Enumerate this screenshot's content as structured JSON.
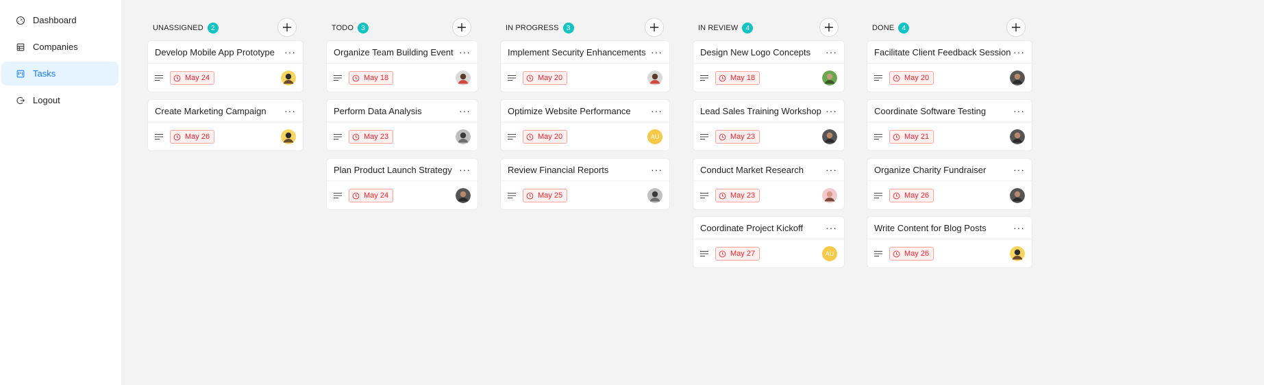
{
  "sidebar": {
    "items": [
      {
        "label": "Dashboard",
        "icon": "dashboard-icon",
        "active": false
      },
      {
        "label": "Companies",
        "icon": "shop-icon",
        "active": false
      },
      {
        "label": "Tasks",
        "icon": "project-icon",
        "active": true
      },
      {
        "label": "Logout",
        "icon": "logout-icon",
        "active": false
      }
    ]
  },
  "colors": {
    "accent": "#1677ff",
    "count_badge": "#13c2c2",
    "date_tag": "#f5222d"
  },
  "columns": [
    {
      "title": "UNASSIGNED",
      "count": "2",
      "cards": [
        {
          "title": "Develop Mobile App Prototype",
          "date": "May 24",
          "avatar": "photo-yellow"
        },
        {
          "title": "Create Marketing Campaign",
          "date": "May 26",
          "avatar": "photo-yellow"
        }
      ]
    },
    {
      "title": "TODO",
      "count": "3",
      "cards": [
        {
          "title": "Organize Team Building Event",
          "date": "May 18",
          "avatar": "photo-red"
        },
        {
          "title": "Perform Data Analysis",
          "date": "May 23",
          "avatar": "photo-gray"
        },
        {
          "title": "Plan Product Launch Strategy",
          "date": "May 24",
          "avatar": "photo-dark"
        }
      ]
    },
    {
      "title": "IN PROGRESS",
      "count": "3",
      "cards": [
        {
          "title": "Implement Security Enhancements",
          "date": "May 20",
          "avatar": "photo-red"
        },
        {
          "title": "Optimize Website Performance",
          "date": "May 20",
          "avatar": "initials",
          "initials": "AU"
        },
        {
          "title": "Review Financial Reports",
          "date": "May 25",
          "avatar": "photo-gray"
        }
      ]
    },
    {
      "title": "IN REVIEW",
      "count": "4",
      "cards": [
        {
          "title": "Design New Logo Concepts",
          "date": "May 18",
          "avatar": "photo-green"
        },
        {
          "title": "Lead Sales Training Workshop",
          "date": "May 23",
          "avatar": "photo-dark"
        },
        {
          "title": "Conduct Market Research",
          "date": "May 23",
          "avatar": "photo-pink"
        },
        {
          "title": "Coordinate Project Kickoff",
          "date": "May 27",
          "avatar": "initials",
          "initials": "AU"
        }
      ]
    },
    {
      "title": "DONE",
      "count": "4",
      "cards": [
        {
          "title": "Facilitate Client Feedback Session",
          "date": "May 20",
          "avatar": "photo-dark"
        },
        {
          "title": "Coordinate Software Testing",
          "date": "May 21",
          "avatar": "photo-dark"
        },
        {
          "title": "Organize Charity Fundraiser",
          "date": "May 26",
          "avatar": "photo-dark"
        },
        {
          "title": "Write Content for Blog Posts",
          "date": "May 26",
          "avatar": "photo-yellow"
        }
      ]
    }
  ]
}
